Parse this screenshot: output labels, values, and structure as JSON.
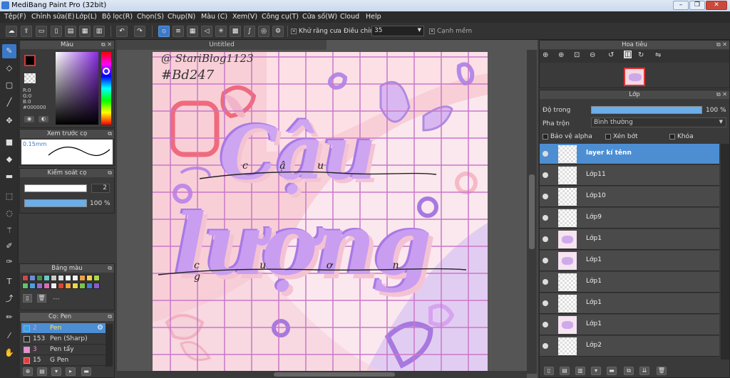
{
  "window": {
    "title": "MediBang Paint Pro (32bit)",
    "controls": [
      "–",
      "❐",
      "✕"
    ]
  },
  "menu": [
    "Tệp(F)",
    "Chỉnh sửa(E)",
    "Lớp(L)",
    "Bộ lọc(R)",
    "Chọn(S)",
    "Chụp(N)",
    "Màu (C)",
    "Xem(V)",
    "Công cụ(T)",
    "Cửa số(W)",
    "Cloud",
    "Help"
  ],
  "toolbar": {
    "antialias_label": "Khử răng cưa",
    "adjust_label": "Điều chỉnh",
    "adjust_value": "35",
    "edge_label": "Cạnh mềm"
  },
  "color_panel": {
    "title": "Màu",
    "r": "R:0",
    "g": "G:0",
    "b": "B:0",
    "hex": "#000000",
    "fg": "#000000",
    "bg": "#ffffff"
  },
  "brush_preview": {
    "title": "Xem trước cọ",
    "size": "0.15mm"
  },
  "brush_control": {
    "title": "Kiểm soát cọ",
    "size_value": "2",
    "opacity_value": "100 %"
  },
  "palette": {
    "title": "Bảng màu",
    "colors": [
      "#c94a4a",
      "#6d8bd9",
      "#4a8f4a",
      "#6cc6c6",
      "#c9c9c9",
      "#e0e0e0",
      "#ffffff",
      "#f2f2f2",
      "#e8a04a",
      "#f6d14a",
      "#a6d94a",
      "#5fc46d",
      "#4a9fe0",
      "#9a6bd1",
      "#d66fb4",
      "#f0f0f0",
      "#d9482f",
      "#f2a03a",
      "#e8d84a",
      "#7cc24a",
      "#3d7fd1",
      "#8a5cc9"
    ],
    "bottom_text": "---"
  },
  "brush_list": {
    "title": "Cọ: Pen",
    "items": [
      {
        "size": "2",
        "name": "Pen",
        "color": "#3aa0e8",
        "selected": true
      },
      {
        "size": "153",
        "name": "Pen (Sharp)",
        "color": "#2b2b2b",
        "selected": false
      },
      {
        "size": "3",
        "name": "Pen tẩy",
        "color": "#f28ad6",
        "selected": false
      },
      {
        "size": "15",
        "name": "G Pen",
        "color": "#e83a3a",
        "selected": false
      }
    ]
  },
  "canvas": {
    "tab_title": "Untitled",
    "signature_line1": "@ StariBlog1123",
    "signature_line2": "#Bd247",
    "word1": "Cậu",
    "word2": "lượng",
    "overlay1": "c ậ u",
    "overlay2": "c u ợ n g"
  },
  "navigator": {
    "title": "Hoa tiêu"
  },
  "layer_panel": {
    "title": "Lớp",
    "opacity_label": "Độ trong",
    "opacity_value": "100 %",
    "blend_label": "Pha trộn",
    "blend_value": "Bình thường",
    "protect_alpha": "Bảo vệ alpha",
    "clip": "Xén bớt",
    "lock": "Khóa"
  },
  "layers": [
    {
      "name": "layer kí tênn",
      "selected": true,
      "art": false
    },
    {
      "name": "Lớp11",
      "selected": false,
      "art": false
    },
    {
      "name": "Lớp10",
      "selected": false,
      "art": false
    },
    {
      "name": "Lớp9",
      "selected": false,
      "art": false
    },
    {
      "name": "Lớp1",
      "selected": false,
      "art": true
    },
    {
      "name": "Lớp1",
      "selected": false,
      "art": true
    },
    {
      "name": "Lớp1",
      "selected": false,
      "art": false
    },
    {
      "name": "Lớp1",
      "selected": false,
      "art": false
    },
    {
      "name": "Lớp1",
      "selected": false,
      "art": true
    },
    {
      "name": "Lớp2",
      "selected": false,
      "art": false
    }
  ]
}
